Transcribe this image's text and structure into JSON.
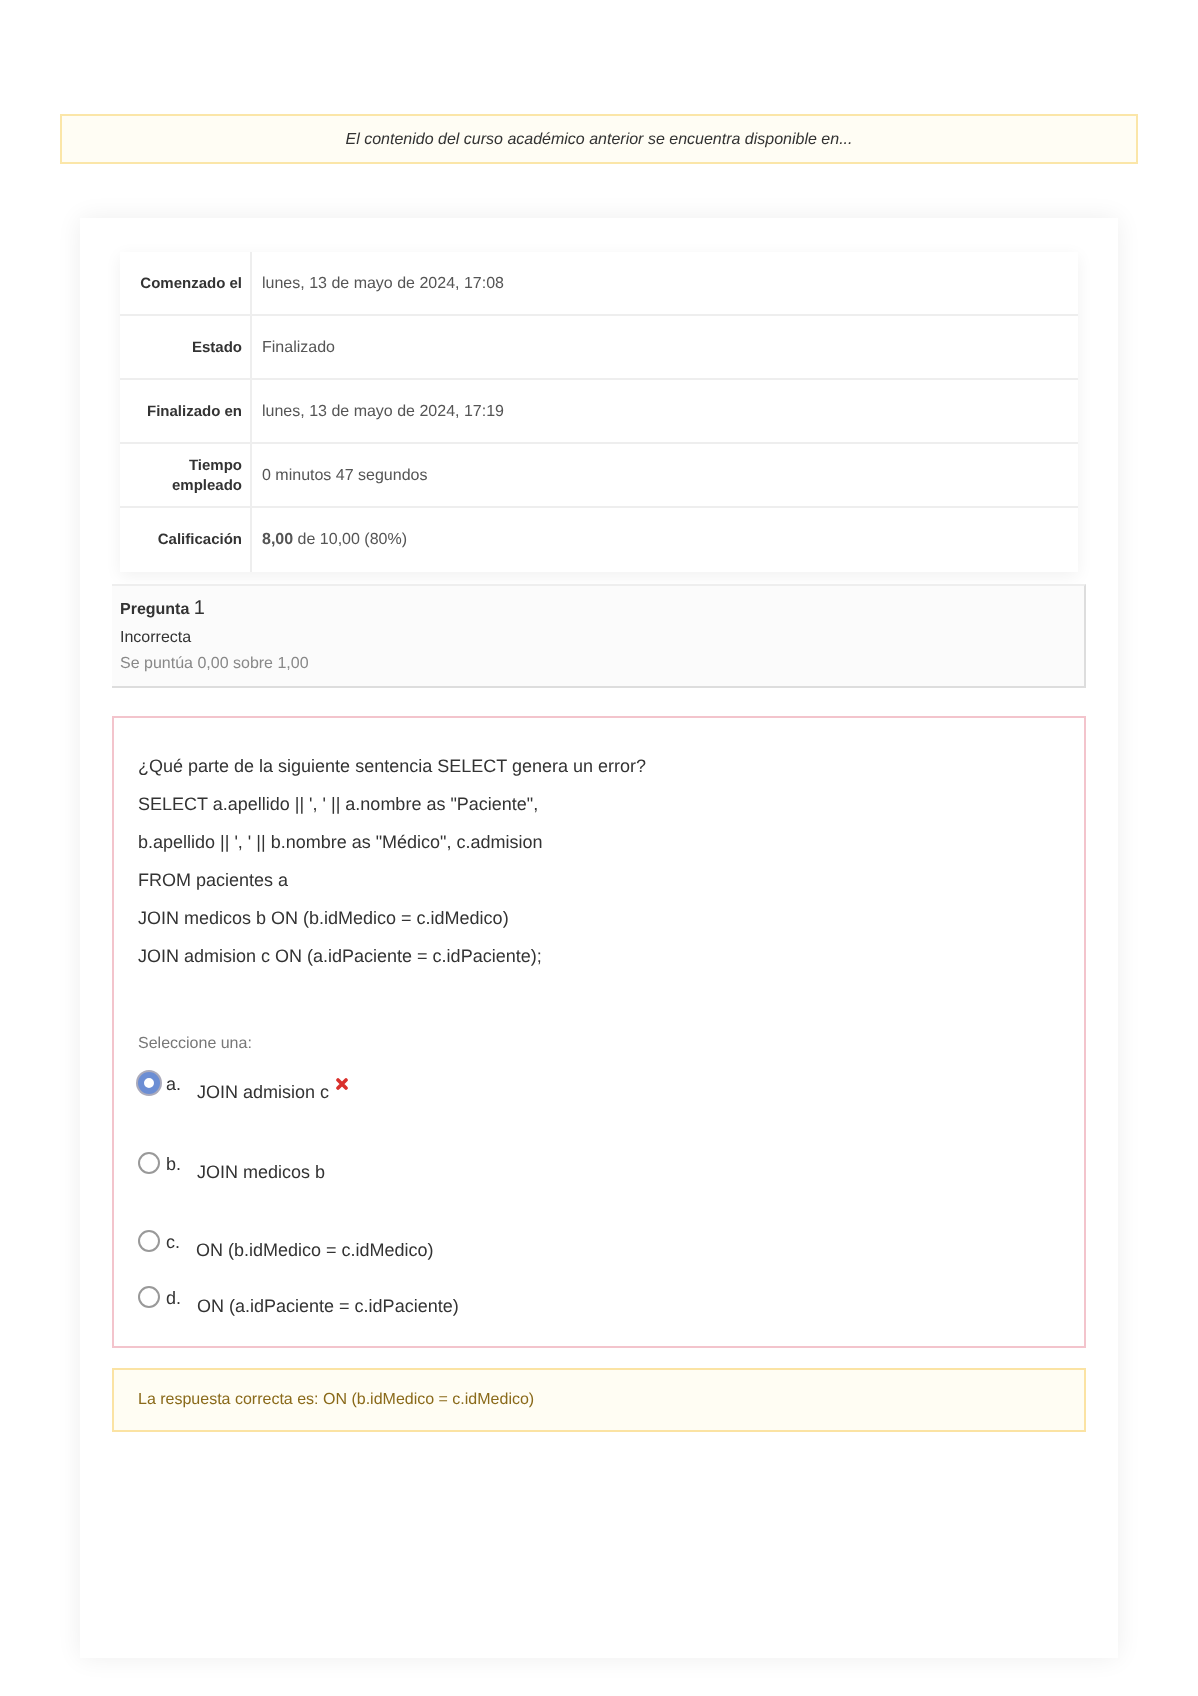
{
  "banner": {
    "text": "El contenido del curso académico anterior se encuentra disponible en..."
  },
  "summary": [
    {
      "label": "Comenzado el",
      "value": "lunes, 13 de mayo de 2024, 17:08"
    },
    {
      "label": "Estado",
      "value": "Finalizado"
    },
    {
      "label": "Finalizado en",
      "value": "lunes, 13 de mayo de 2024, 17:19"
    },
    {
      "label": "Tiempo empleado",
      "value": "0 minutos 47 segundos"
    },
    {
      "label": "Calificación",
      "value": "**8,00** de 10,00 (80%)"
    }
  ],
  "question_info": {
    "prefix": "Pregunta",
    "number": "1",
    "state": "Incorrecta",
    "score": "Se puntúa 0,00 sobre 1,00"
  },
  "question": {
    "lines": [
      "¿Qué parte de la siguiente sentencia SELECT genera un error?",
      "SELECT a.apellido || ', ' || a.nombre as \"Paciente\",",
      "b.apellido || ', ' || b.nombre as \"Médico\", c.admision",
      "FROM pacientes a",
      "JOIN medicos b ON (b.idMedico = c.idMedico)",
      "JOIN admision c ON (a.idPaciente = c.idPaciente);"
    ],
    "prompt": "Seleccione una:",
    "options": [
      {
        "letter": "a.",
        "text": "JOIN admision c",
        "selected": true,
        "incorrect": true
      },
      {
        "letter": "b.",
        "text": "JOIN medicos b",
        "selected": false,
        "incorrect": false
      },
      {
        "letter": "c.",
        "text": "ON (b.idMedico = c.idMedico)",
        "selected": false,
        "incorrect": false
      },
      {
        "letter": "d.",
        "text": "ON (a.idPaciente = c.idPaciente)",
        "selected": false,
        "incorrect": false
      }
    ]
  },
  "feedback": {
    "text": "La respuesta correcta es: ON (b.idMedico = c.idMedico)"
  }
}
